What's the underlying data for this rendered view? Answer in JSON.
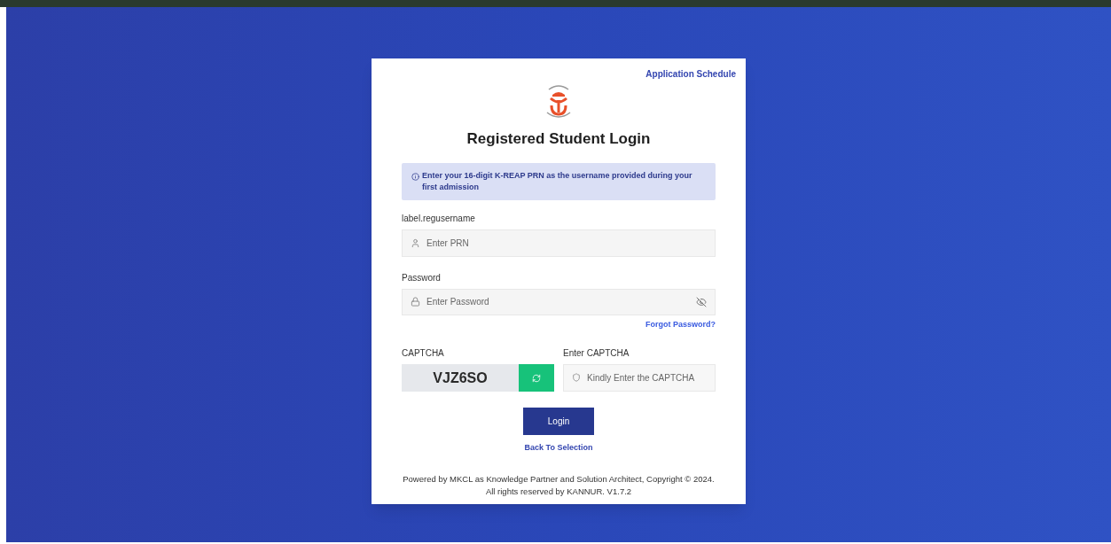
{
  "header_link": "Application Schedule",
  "title": "Registered Student Login",
  "notice": "Enter your 16-digit K-REAP PRN as the username provided during your first admission",
  "username": {
    "label": "label.regusername",
    "placeholder": "Enter PRN"
  },
  "password": {
    "label": "Password",
    "placeholder": "Enter Password"
  },
  "forgot_link": "Forgot Password?",
  "captcha": {
    "label": "CAPTCHA",
    "code": "VJZ6SO",
    "input_label": "Enter CAPTCHA",
    "placeholder": "Kindly Enter the CAPTCHA"
  },
  "login_button": "Login",
  "back_link": "Back To Selection",
  "footer": [
    "Powered by MKCL as Knowledge Partner and Solution Architect, Copyright © 2024.",
    "All rights reserved by KANNUR. V1.7.2"
  ]
}
